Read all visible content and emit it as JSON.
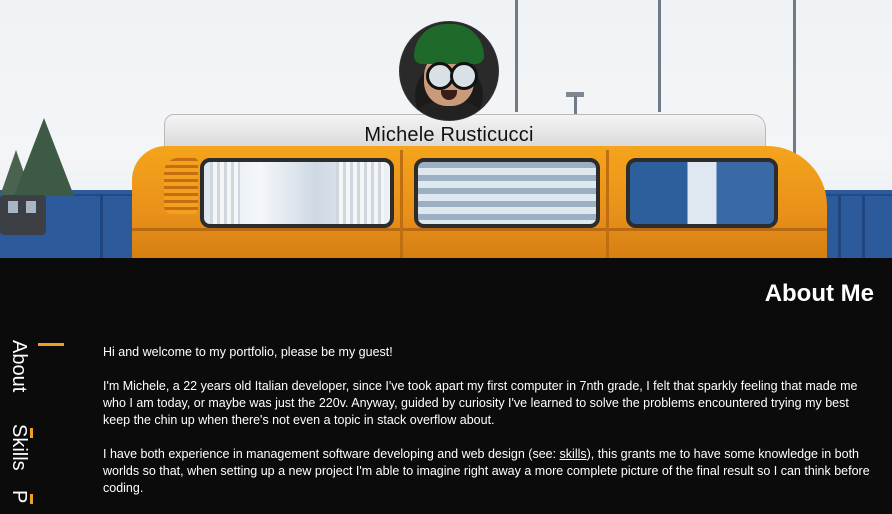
{
  "profile": {
    "name": "Michele Rusticucci"
  },
  "sections": {
    "about_title": "About Me"
  },
  "nav": {
    "items": [
      {
        "label": "About"
      },
      {
        "label": "Skills"
      },
      {
        "label": "P"
      }
    ]
  },
  "content": {
    "p1": "Hi and welcome to my portfolio, please be my guest!",
    "p2": "I'm Michele, a 22 years old Italian developer, since I've took apart my first computer in 7nth grade, I felt that sparkly feeling that made me who I am today, or maybe was just the 220v. Anyway, guided by curiosity I've learned to solve the problems encountered trying my best keep the chin up when there's not even a topic in stack overflow about.",
    "p3_before": "I have both experience in management software developing and web design (see: ",
    "p3_link": "skills",
    "p3_after": "), this grants me to have some knowledge in both worlds so that, when setting up a new project I'm able to imagine right away a more complete picture of the final result so I can think before coding."
  },
  "colors": {
    "accent": "#f0a020",
    "background": "#0b0b0b",
    "text": "#ffffff"
  },
  "icons": [
    "avatar-photo"
  ]
}
